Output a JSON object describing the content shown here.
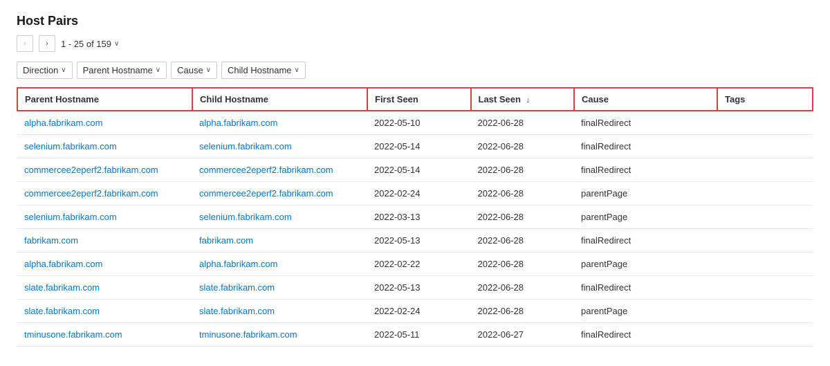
{
  "page": {
    "title": "Host Pairs",
    "pagination": {
      "prev_label": "‹",
      "next_label": "›",
      "info": "1 - 25 of 159",
      "chevron": "∨"
    },
    "filters": [
      {
        "id": "direction",
        "label": "Direction"
      },
      {
        "id": "parent-hostname",
        "label": "Parent Hostname"
      },
      {
        "id": "cause",
        "label": "Cause"
      },
      {
        "id": "child-hostname",
        "label": "Child Hostname"
      }
    ],
    "table": {
      "columns": [
        {
          "id": "parent-hostname",
          "label": "Parent Hostname",
          "sortable": false,
          "highlighted": true
        },
        {
          "id": "child-hostname",
          "label": "Child Hostname",
          "sortable": false,
          "highlighted": true
        },
        {
          "id": "first-seen",
          "label": "First Seen",
          "sortable": false,
          "highlighted": true
        },
        {
          "id": "last-seen",
          "label": "Last Seen",
          "sortable": true,
          "sort_dir": "↓",
          "highlighted": true
        },
        {
          "id": "cause",
          "label": "Cause",
          "sortable": false,
          "highlighted": true
        },
        {
          "id": "tags",
          "label": "Tags",
          "sortable": false,
          "highlighted": true
        }
      ],
      "rows": [
        {
          "parent": "alpha.fabrikam.com",
          "child": "alpha.fabrikam.com",
          "first_seen": "2022-05-10",
          "last_seen": "2022-06-28",
          "cause": "finalRedirect",
          "tags": ""
        },
        {
          "parent": "selenium.fabrikam.com",
          "child": "selenium.fabrikam.com",
          "first_seen": "2022-05-14",
          "last_seen": "2022-06-28",
          "cause": "finalRedirect",
          "tags": ""
        },
        {
          "parent": "commercee2eperf2.fabrikam.com",
          "child": "commercee2eperf2.fabrikam.com",
          "first_seen": "2022-05-14",
          "last_seen": "2022-06-28",
          "cause": "finalRedirect",
          "tags": ""
        },
        {
          "parent": "commercee2eperf2.fabrikam.com",
          "child": "commercee2eperf2.fabrikam.com",
          "first_seen": "2022-02-24",
          "last_seen": "2022-06-28",
          "cause": "parentPage",
          "tags": ""
        },
        {
          "parent": "selenium.fabrikam.com",
          "child": "selenium.fabrikam.com",
          "first_seen": "2022-03-13",
          "last_seen": "2022-06-28",
          "cause": "parentPage",
          "tags": ""
        },
        {
          "parent": "fabrikam.com",
          "child": "fabrikam.com",
          "first_seen": "2022-05-13",
          "last_seen": "2022-06-28",
          "cause": "finalRedirect",
          "tags": ""
        },
        {
          "parent": "alpha.fabrikam.com",
          "child": "alpha.fabrikam.com",
          "first_seen": "2022-02-22",
          "last_seen": "2022-06-28",
          "cause": "parentPage",
          "tags": ""
        },
        {
          "parent": "slate.fabrikam.com",
          "child": "slate.fabrikam.com",
          "first_seen": "2022-05-13",
          "last_seen": "2022-06-28",
          "cause": "finalRedirect",
          "tags": ""
        },
        {
          "parent": "slate.fabrikam.com",
          "child": "slate.fabrikam.com",
          "first_seen": "2022-02-24",
          "last_seen": "2022-06-28",
          "cause": "parentPage",
          "tags": ""
        },
        {
          "parent": "tminusone.fabrikam.com",
          "child": "tminusone.fabrikam.com",
          "first_seen": "2022-05-11",
          "last_seen": "2022-06-27",
          "cause": "finalRedirect",
          "tags": ""
        }
      ]
    }
  }
}
